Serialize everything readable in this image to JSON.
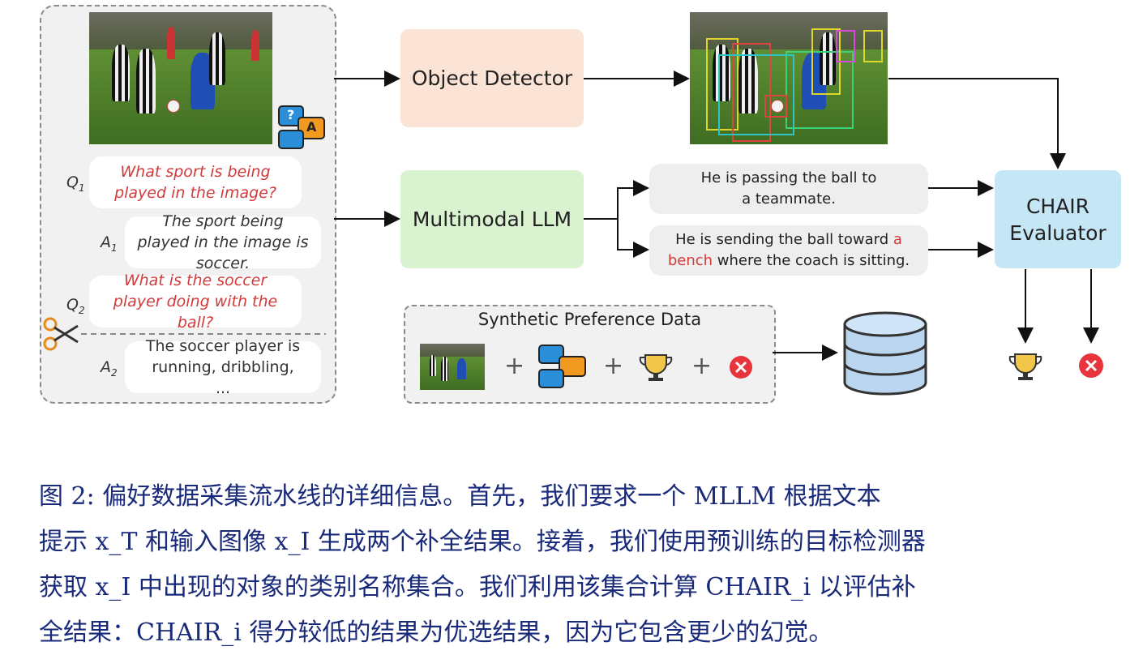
{
  "left_panel": {
    "q1_label": "Q",
    "q1_sub": "1",
    "q1_text": "What sport is being played in the image?",
    "a1_label": "A",
    "a1_sub": "1",
    "a1_text": "The sport being played in the image is soccer.",
    "q2_label": "Q",
    "q2_sub": "2",
    "q2_text": "What is the soccer player doing with the ball?",
    "a2_label": "A",
    "a2_sub": "2",
    "a2_text": "The soccer player is running, dribbling, ..."
  },
  "qa_icon": {
    "q": "?",
    "a": "A"
  },
  "boxes": {
    "object_detector": "Object Detector",
    "multimodal_llm": "Multimodal LLM",
    "chair_evaluator_line1": "CHAIR",
    "chair_evaluator_line2": "Evaluator"
  },
  "responses": {
    "r1_line1": "He is passing the ball to",
    "r1_line2": "a teammate.",
    "r2_pre": "He is sending the ball toward ",
    "r2_red1": "a",
    "r2_red2": "bench",
    "r2_post": " where the coach is sitting."
  },
  "synthetic": {
    "title": "Synthetic Preference Data",
    "plus": "+"
  },
  "colors": {
    "detector_fill": "#fbe3d6",
    "llm_fill": "#d9f2d0",
    "chair_fill": "#c5e6f5",
    "red_text": "#d23b3b",
    "caption_text": "#1a2a7a"
  },
  "caption": {
    "line1": "图 2: 偏好数据采集流水线的详细信息。首先，我们要求一个 MLLM 根据文本",
    "line2": "提示 x_T 和输入图像 x_I 生成两个补全结果。接着，我们使用预训练的目标检测器",
    "line3": "获取 x_I 中出现的对象的类别名称集合。我们利用该集合计算 CHAIR_i 以评估补",
    "line4": "全结果：CHAIR_i 得分较低的结果为优选结果，因为它包含更少的幻觉。"
  }
}
